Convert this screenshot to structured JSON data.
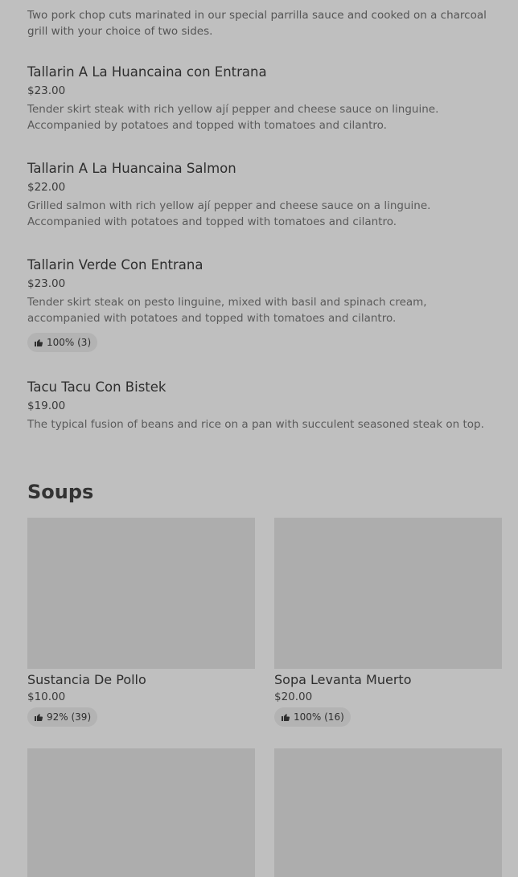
{
  "partial_item": {
    "description": "Two pork chop cuts marinated in our special parrilla sauce and cooked on a charcoal grill with your choice of two sides."
  },
  "menu_items": [
    {
      "title": "Tallarin A La Huancaina con Entrana",
      "price": "$23.00",
      "description": "Tender skirt steak with rich yellow ají pepper and cheese sauce on linguine. Accompanied by potatoes and topped with tomatoes and cilantro."
    },
    {
      "title": "Tallarin A La Huancaina Salmon",
      "price": "$22.00",
      "description": "Grilled salmon with rich yellow ají pepper and cheese sauce on a linguine. Accompanied with potatoes and topped with tomatoes and cilantro."
    },
    {
      "title": "Tallarin Verde Con Entrana",
      "price": "$23.00",
      "description": "Tender skirt steak on pesto linguine, mixed with basil and spinach cream, accompanied with potatoes and topped with tomatoes and cilantro.",
      "rating": "100% (3)"
    },
    {
      "title": "Tacu Tacu Con Bistek",
      "price": "$19.00",
      "description": "The typical fusion of beans and rice on a pan with succulent seasoned steak on top."
    }
  ],
  "soups_section": {
    "title": "Soups",
    "cards": [
      {
        "title": "Sustancia De Pollo",
        "price": "$10.00",
        "rating": "92% (39)"
      },
      {
        "title": "Sopa Levanta Muerto",
        "price": "$20.00",
        "rating": "100% (16)"
      }
    ]
  },
  "icons": {
    "rating": "thumbs-up-icon"
  },
  "colors": {
    "background": "#bfbfbf",
    "image_placeholder": "#adadad",
    "badge": "#b3b3b3"
  }
}
